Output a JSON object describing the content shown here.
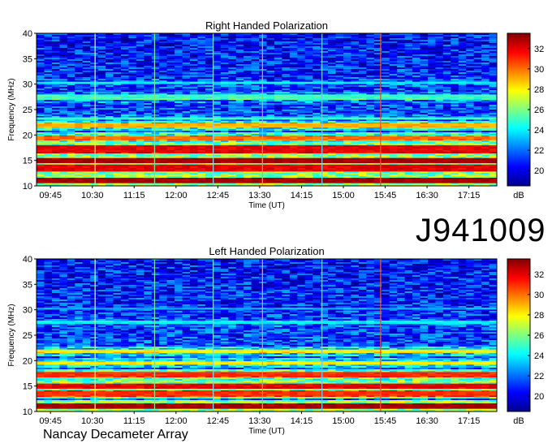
{
  "observation_id": "J941009",
  "instrument": "Nancay Decameter Array",
  "chart_data": [
    {
      "type": "heatmap",
      "title": "Right Handed Polarization",
      "xlabel": "Time (UT)",
      "ylabel": "Frequency (MHz)",
      "x_ticks": [
        "09:45",
        "10:30",
        "11:15",
        "12:00",
        "12:45",
        "13:30",
        "14:15",
        "15:00",
        "15:45",
        "16:30",
        "17:15"
      ],
      "y_ticks": [
        10,
        15,
        20,
        25,
        30,
        35,
        40
      ],
      "ylim": [
        10,
        40
      ],
      "xlim": [
        "09:30",
        "17:45"
      ],
      "colorbar": {
        "label": "dB",
        "ticks": [
          20,
          22,
          24,
          26,
          28,
          30,
          32
        ],
        "range": [
          18.5,
          33.5
        ]
      },
      "vertical_lines": [
        {
          "time": "10:33",
          "color": "#d8f06a"
        },
        {
          "time": "11:37",
          "color": "#7fe08a"
        },
        {
          "time": "12:40",
          "color": "#7ad8e8"
        },
        {
          "time": "13:33",
          "color": "#f0a040"
        },
        {
          "time": "14:37",
          "color": "#6cc8f0"
        },
        {
          "time": "15:40",
          "color": "#f05030"
        }
      ],
      "bands": [
        {
          "f_low": 10.5,
          "f_high": 11.5,
          "level": 33
        },
        {
          "f_low": 12.8,
          "f_high": 14.2,
          "level": 32
        },
        {
          "f_low": 14.5,
          "f_high": 15.5,
          "level": 33
        },
        {
          "f_low": 16.5,
          "f_high": 18.0,
          "level": 32
        },
        {
          "f_low": 19.0,
          "f_high": 19.8,
          "level": 30
        },
        {
          "f_low": 21.5,
          "f_high": 22.3,
          "level": 29
        },
        {
          "f_low": 23.0,
          "f_high": 23.5,
          "level": 25
        },
        {
          "f_low": 27.0,
          "f_high": 28.0,
          "level": 25
        },
        {
          "f_low": 30.0,
          "f_high": 30.5,
          "level": 24
        }
      ]
    },
    {
      "type": "heatmap",
      "title": "Left Handed Polarization",
      "xlabel": "Time (UT)",
      "ylabel": "Frequency (MHz)",
      "x_ticks": [
        "09:45",
        "10:30",
        "11:15",
        "12:00",
        "12:45",
        "13:30",
        "14:15",
        "15:00",
        "15:45",
        "16:30",
        "17:15"
      ],
      "y_ticks": [
        10,
        15,
        20,
        25,
        30,
        35,
        40
      ],
      "ylim": [
        10,
        40
      ],
      "xlim": [
        "09:30",
        "17:45"
      ],
      "colorbar": {
        "label": "dB",
        "ticks": [
          20,
          22,
          24,
          26,
          28,
          30,
          32
        ],
        "range": [
          18.5,
          33.5
        ]
      },
      "vertical_lines": [
        {
          "time": "10:33",
          "color": "#d8f06a"
        },
        {
          "time": "11:37",
          "color": "#7fe08a"
        },
        {
          "time": "12:40",
          "color": "#7ad8e8"
        },
        {
          "time": "13:33",
          "color": "#f0a040"
        },
        {
          "time": "14:37",
          "color": "#6cc8f0"
        },
        {
          "time": "15:40",
          "color": "#f05030"
        }
      ],
      "bands": [
        {
          "f_low": 10.5,
          "f_high": 11.5,
          "level": 33
        },
        {
          "f_low": 13.0,
          "f_high": 14.0,
          "level": 31
        },
        {
          "f_low": 14.5,
          "f_high": 15.5,
          "level": 32
        },
        {
          "f_low": 16.8,
          "f_high": 17.8,
          "level": 31
        },
        {
          "f_low": 19.2,
          "f_high": 19.8,
          "level": 28
        },
        {
          "f_low": 21.6,
          "f_high": 22.2,
          "level": 28
        },
        {
          "f_low": 27.2,
          "f_high": 27.8,
          "level": 24
        },
        {
          "f_low": 30.0,
          "f_high": 30.4,
          "level": 23
        }
      ]
    }
  ]
}
